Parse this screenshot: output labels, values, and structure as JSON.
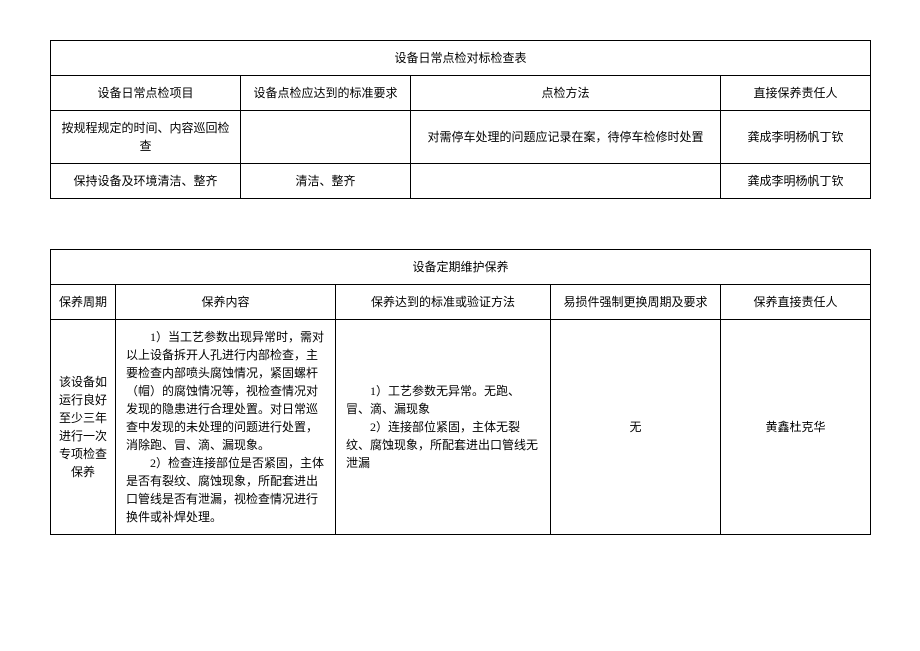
{
  "table1": {
    "title": "设备日常点检对标检查表",
    "headers": {
      "h1": "设备日常点检项目",
      "h2": "设备点检应达到的标准要求",
      "h3": "点检方法",
      "h4": "直接保养责任人"
    },
    "rows": [
      {
        "c1": "按规程规定的时间、内容巡回检查",
        "c2": "",
        "c3": "对需停车处理的问题应记录在案，待停车检修时处置",
        "c4": "龚成李明杨帆丁钦"
      },
      {
        "c1": "保持设备及环境清洁、整齐",
        "c2": "清洁、整齐",
        "c3": "",
        "c4": "龚成李明杨帆丁钦"
      }
    ]
  },
  "table2": {
    "title": "设备定期维护保养",
    "headers": {
      "h1": "保养周期",
      "h2": "保养内容",
      "h3": "保养达到的标准或验证方法",
      "h4": "易损件强制更换周期及要求",
      "h5": "保养直接责任人"
    },
    "row": {
      "c1": "该设备如运行良好至少三年进行一次专项检查保养",
      "c2_p1": "1）当工艺参数出现异常时，需对以上设备拆开人孔进行内部检查，主要检查内部喷头腐蚀情况，紧固螺杆（帽）的腐蚀情况等，视检查情况对发现的隐患进行合理处置。对日常巡查中发现的未处理的问题进行处置，消除跑、冒、滴、漏现象。",
      "c2_p2": "2）检查连接部位是否紧固，主体是否有裂纹、腐蚀现象，所配套进出口管线是否有泄漏，视检查情况进行换件或补焊处理。",
      "c3_p1": "1）工艺参数无异常。无跑、冒、滴、漏现象",
      "c3_p2": "2）连接部位紧固，主体无裂纹、腐蚀现象，所配套进出口管线无泄漏",
      "c4": "无",
      "c5": "黄鑫杜克华"
    }
  }
}
